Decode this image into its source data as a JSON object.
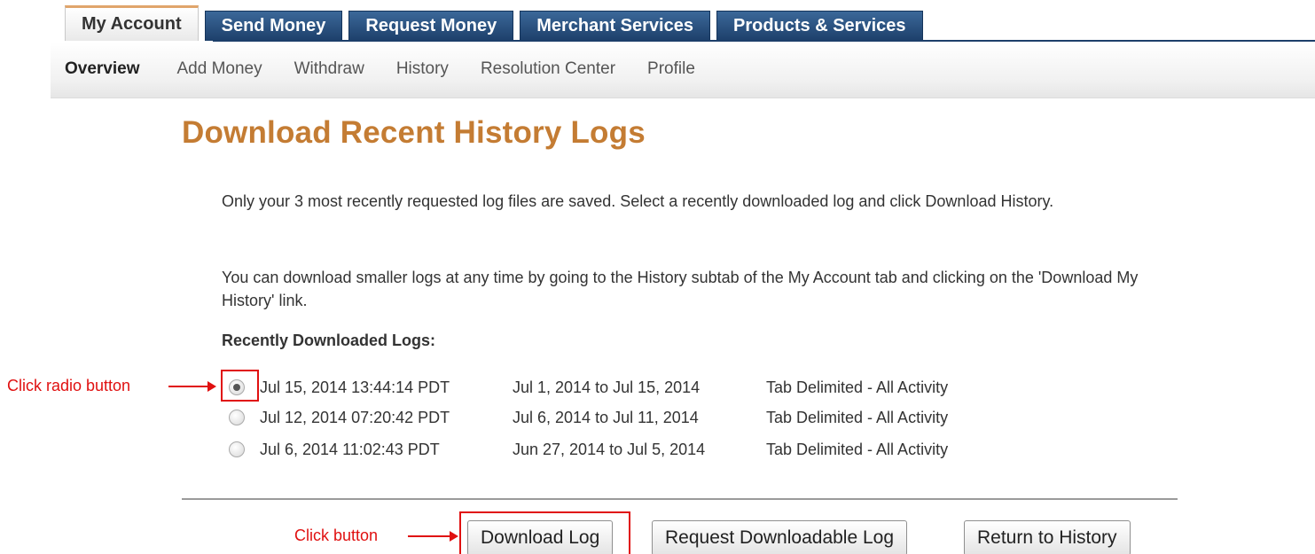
{
  "tabs": [
    {
      "label": "My Account",
      "active": true
    },
    {
      "label": "Send Money"
    },
    {
      "label": "Request Money"
    },
    {
      "label": "Merchant Services"
    },
    {
      "label": "Products & Services"
    }
  ],
  "subnav": [
    "Overview",
    "Add Money",
    "Withdraw",
    "History",
    "Resolution Center",
    "Profile"
  ],
  "page_title": "Download Recent History Logs",
  "intro_1": "Only your 3 most recently requested log files are saved. Select a recently downloaded log and click Download History.",
  "intro_2": "You can download smaller logs at any time by going to the History subtab of the My Account tab and clicking on the 'Download My History' link.",
  "logs_heading": "Recently Downloaded Logs:",
  "logs": [
    {
      "date": "Jul 15, 2014 13:44:14 PDT",
      "range": "Jul 1, 2014 to Jul 15, 2014",
      "type": "Tab Delimited - All Activity",
      "selected": true
    },
    {
      "date": "Jul 12, 2014 07:20:42 PDT",
      "range": "Jul 6, 2014 to Jul 11, 2014",
      "type": "Tab Delimited - All Activity",
      "selected": false
    },
    {
      "date": "Jul 6, 2014 11:02:43 PDT",
      "range": "Jun 27, 2014 to Jul 5, 2014",
      "type": "Tab Delimited - All Activity",
      "selected": false
    }
  ],
  "buttons": {
    "download": "Download Log",
    "request": "Request Downloadable Log",
    "return": "Return to History"
  },
  "annotations": {
    "radio": "Click radio button",
    "button": "Click button"
  },
  "colors": {
    "title": "#c47c33",
    "tab_blue": "#1d3f6a",
    "annotation_red": "#e01010"
  }
}
